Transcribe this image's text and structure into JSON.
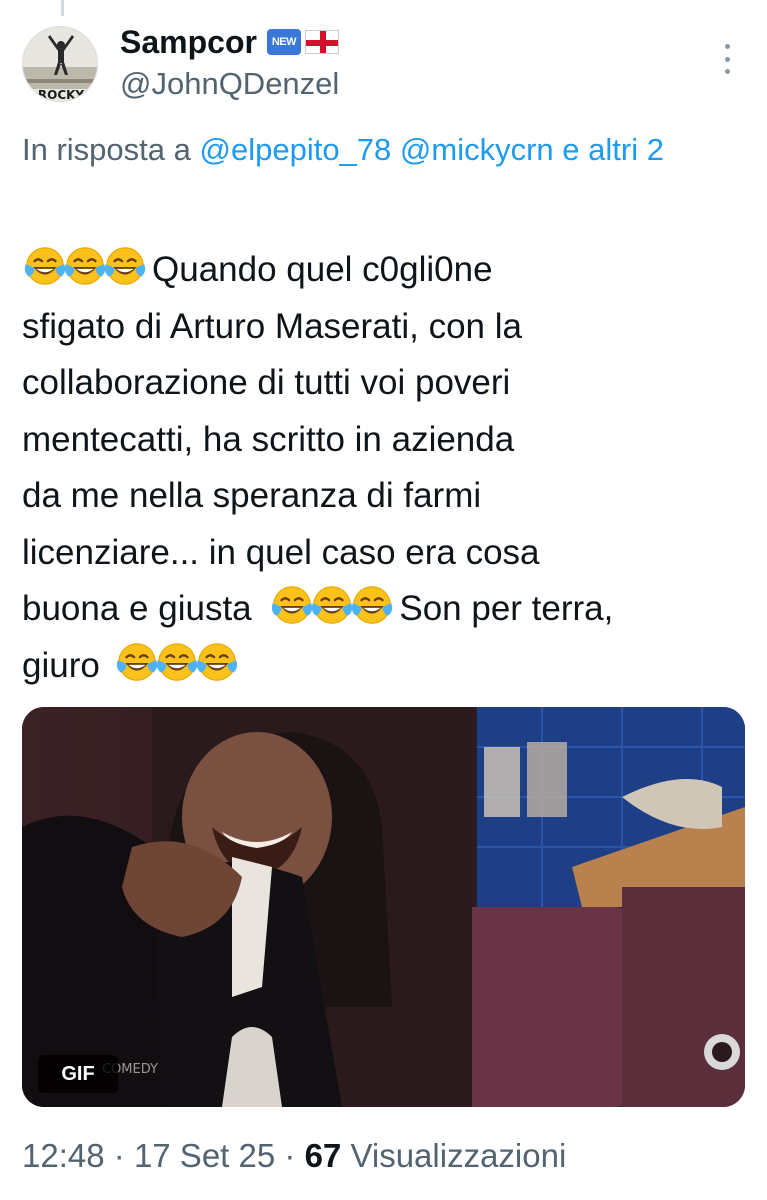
{
  "author": {
    "display_name": "Sampcor",
    "badge": "NEW",
    "flag_icon": "england-flag-icon",
    "handle": "@JohnQDenzel",
    "avatar_text": "ROCKY"
  },
  "reply": {
    "prefix": "In risposta a",
    "mentions": [
      "@elpepito_78",
      "@mickycrn"
    ],
    "suffix": "e altri 2"
  },
  "tweet": {
    "line1": "Quando quel c0gli0ne",
    "line2": "sfigato di Arturo Maserati, con la",
    "line3": "collaborazione di tutti voi poveri",
    "line4": "mentecatti, ha scritto in azienda",
    "line5": "da me nella speranza di farmi",
    "line6": "licenziare... in quel caso era cosa",
    "line7a": "buona e giusta",
    "line7b": "Son per terra,",
    "line8": "giuro",
    "emoji_icon": "face-with-tears-of-joy-icon"
  },
  "media": {
    "gif_label": "GIF",
    "watermark": "COMEDY"
  },
  "meta": {
    "time": "12:48",
    "sep": "·",
    "date": "17 Set 25",
    "views_count": "67",
    "views_label": "Visualizzazioni"
  },
  "colors": {
    "link": "#1d9bf0",
    "secondary_text": "#536471",
    "primary_text": "#0f1419"
  }
}
